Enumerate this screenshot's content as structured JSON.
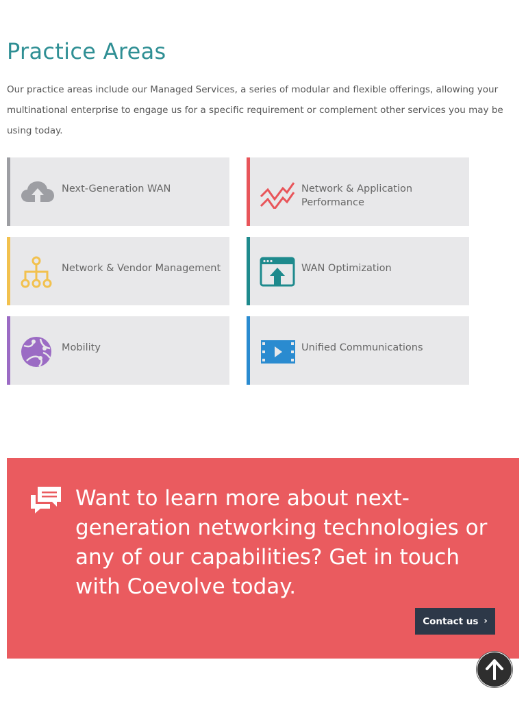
{
  "page": {
    "title": "Practice Areas",
    "intro": "Our practice areas include our Managed Services, a series of modular and flexible offerings, allowing your multinational enterprise to engage us for a specific requirement or complement other services you may be using today."
  },
  "practice_areas": [
    {
      "label": "Next-Generation WAN",
      "icon": "cloud-upload-icon",
      "accent": "#9d9ea3"
    },
    {
      "label": "Network & Application Performance",
      "icon": "trend-chart-icon",
      "accent": "#e8555a"
    },
    {
      "label": "Network & Vendor Management",
      "icon": "hierarchy-icon",
      "accent": "#f2c14e"
    },
    {
      "label": "WAN Optimization",
      "icon": "window-upload-icon",
      "accent": "#1e8a8d"
    },
    {
      "label": "Mobility",
      "icon": "globe-icon",
      "accent": "#9b6bc4"
    },
    {
      "label": "Unified Communications",
      "icon": "video-play-icon",
      "accent": "#2a8bd0"
    }
  ],
  "cta": {
    "headline": "Want to learn more about next-generation networking technologies or any of our capabilities? Get in touch with Coevolve today.",
    "button_label": "Contact us",
    "icon": "chat-bubbles-icon",
    "background": "#ea5b5f"
  },
  "scroll_top": {
    "icon": "arrow-up-icon"
  }
}
